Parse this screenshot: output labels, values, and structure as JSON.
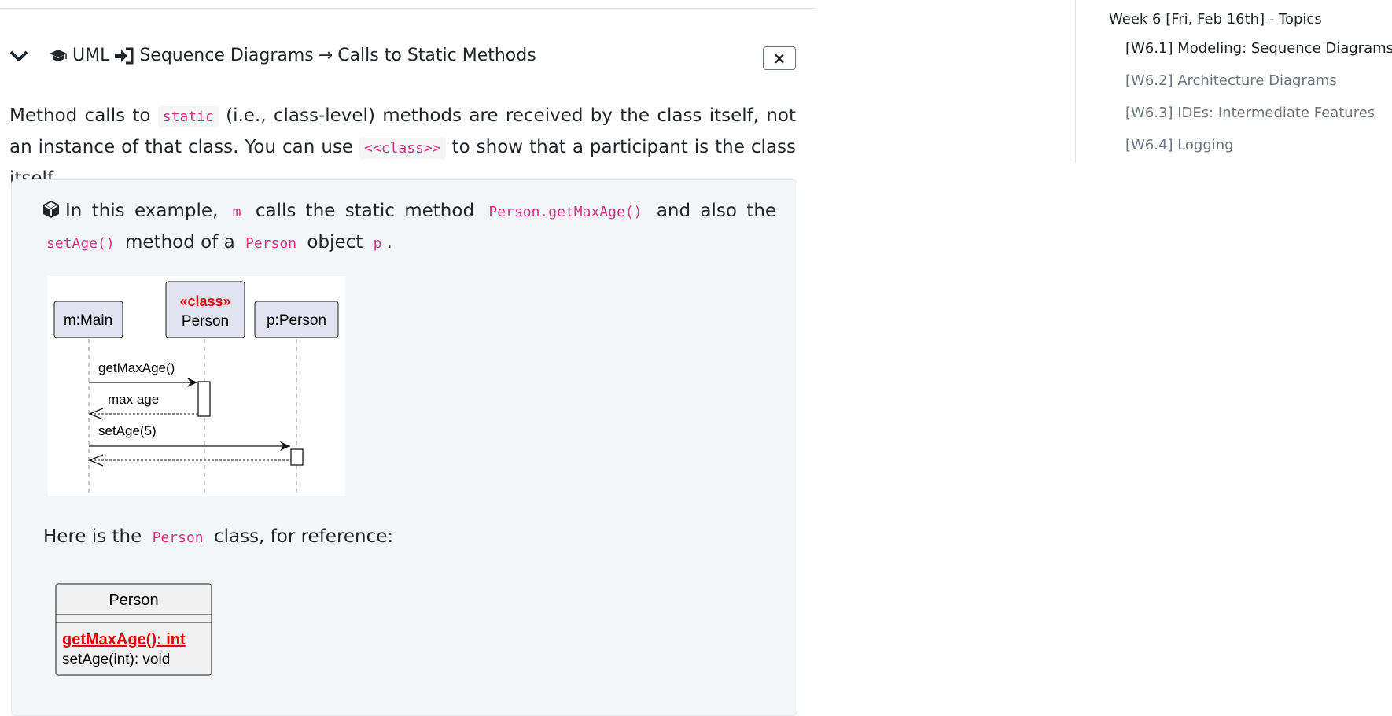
{
  "header": {
    "title_part1": "UML",
    "title_part2": "Sequence Diagrams",
    "arrow": "→",
    "title_part3": "Calls to Static Methods",
    "close_label": "×"
  },
  "intro": {
    "t1": "Method calls to",
    "code1": "static",
    "t2": "(i.e., class-level) methods are received by the class itself, not an instance of that class. You can use",
    "code2": "<<class>>",
    "t3": "to show that a participant is the class itself."
  },
  "example": {
    "t1": "In this example,",
    "code1": "m",
    "t2": "calls the static method",
    "code2": "Person.getMaxAge()",
    "t3": "and also the",
    "code3": "setAge()",
    "t4": "method of a",
    "code4": "Person",
    "t5": "object",
    "code5": "p",
    "t6": "."
  },
  "sequence_diagram": {
    "participants": [
      {
        "label": "m:Main"
      },
      {
        "stereotype": "«class»",
        "label": "Person"
      },
      {
        "label": "p:Person"
      }
    ],
    "messages": [
      {
        "label": "getMaxAge()"
      },
      {
        "label": "max age"
      },
      {
        "label": "setAge(5)"
      }
    ]
  },
  "reference": {
    "t1": "Here is the",
    "code1": "Person",
    "t2": "class, for reference:"
  },
  "class_diagram": {
    "name": "Person",
    "methods": [
      "getMaxAge(): int",
      "setAge(int): void"
    ]
  },
  "toc": {
    "heading": "Week 6 [Fri, Feb 16th] - Topics",
    "items": [
      {
        "label": "[W6.1] Modeling: Sequence Diagrams"
      },
      {
        "label": "[W6.2] Architecture Diagrams"
      },
      {
        "label": "[W6.3] IDEs: Intermediate Features"
      },
      {
        "label": "[W6.4] Logging"
      }
    ]
  },
  "colors": {
    "code": "#d63384",
    "stereotype": "#e60000",
    "participant_fill": "#e2e2f0"
  }
}
